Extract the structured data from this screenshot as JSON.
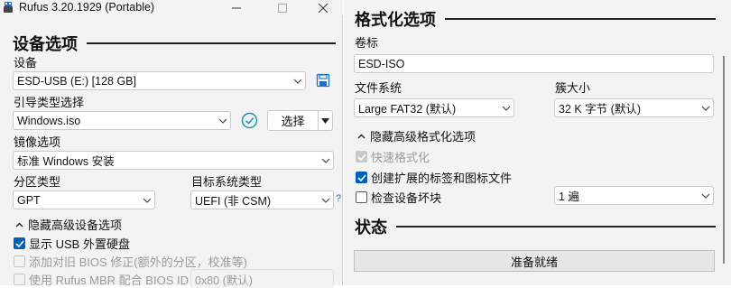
{
  "window": {
    "title": "Rufus 3.20.1929 (Portable)"
  },
  "device_section": {
    "heading": "设备选项",
    "device_label": "设备",
    "device_value": "ESD-USB (E:) [128 GB]",
    "boot_label": "引导类型选择",
    "boot_value": "Windows.iso",
    "select_button": "选择",
    "image_label": "镜像选项",
    "image_value": "标准 Windows 安装",
    "partition_label": "分区类型",
    "partition_value": "GPT",
    "target_label": "目标系统类型",
    "target_value": "UEFI (非 CSM)",
    "help_mark": "?",
    "advanced_toggle": "隐藏高级设备选项",
    "opt_usb_hdd": "显示 USB 外置硬盘",
    "opt_bios_fix": "添加对旧 BIOS 修正(额外的分区，校准等)",
    "opt_mbr": "使用 Rufus MBR 配合 BIOS ID",
    "mbr_value": "0x80 (默认)"
  },
  "format_section": {
    "heading": "格式化选项",
    "volume_label": "卷标",
    "volume_value": "ESD-ISO",
    "fs_label": "文件系统",
    "fs_value": "Large FAT32 (默认)",
    "cluster_label": "簇大小",
    "cluster_value": "32 K 字节 (默认)",
    "advanced_toggle": "隐藏高级格式化选项",
    "opt_quick": "快速格式化",
    "opt_ext_label": "创建扩展的标签和图标文件",
    "opt_bad_blocks": "检查设备坏块",
    "passes_value": "1 遍"
  },
  "status_section": {
    "heading": "状态",
    "progress_text": "准备就绪"
  },
  "colors": {
    "accent": "#005fb8",
    "window_bg": "#f3f3f3",
    "check_teal": "#1f8fa8"
  }
}
